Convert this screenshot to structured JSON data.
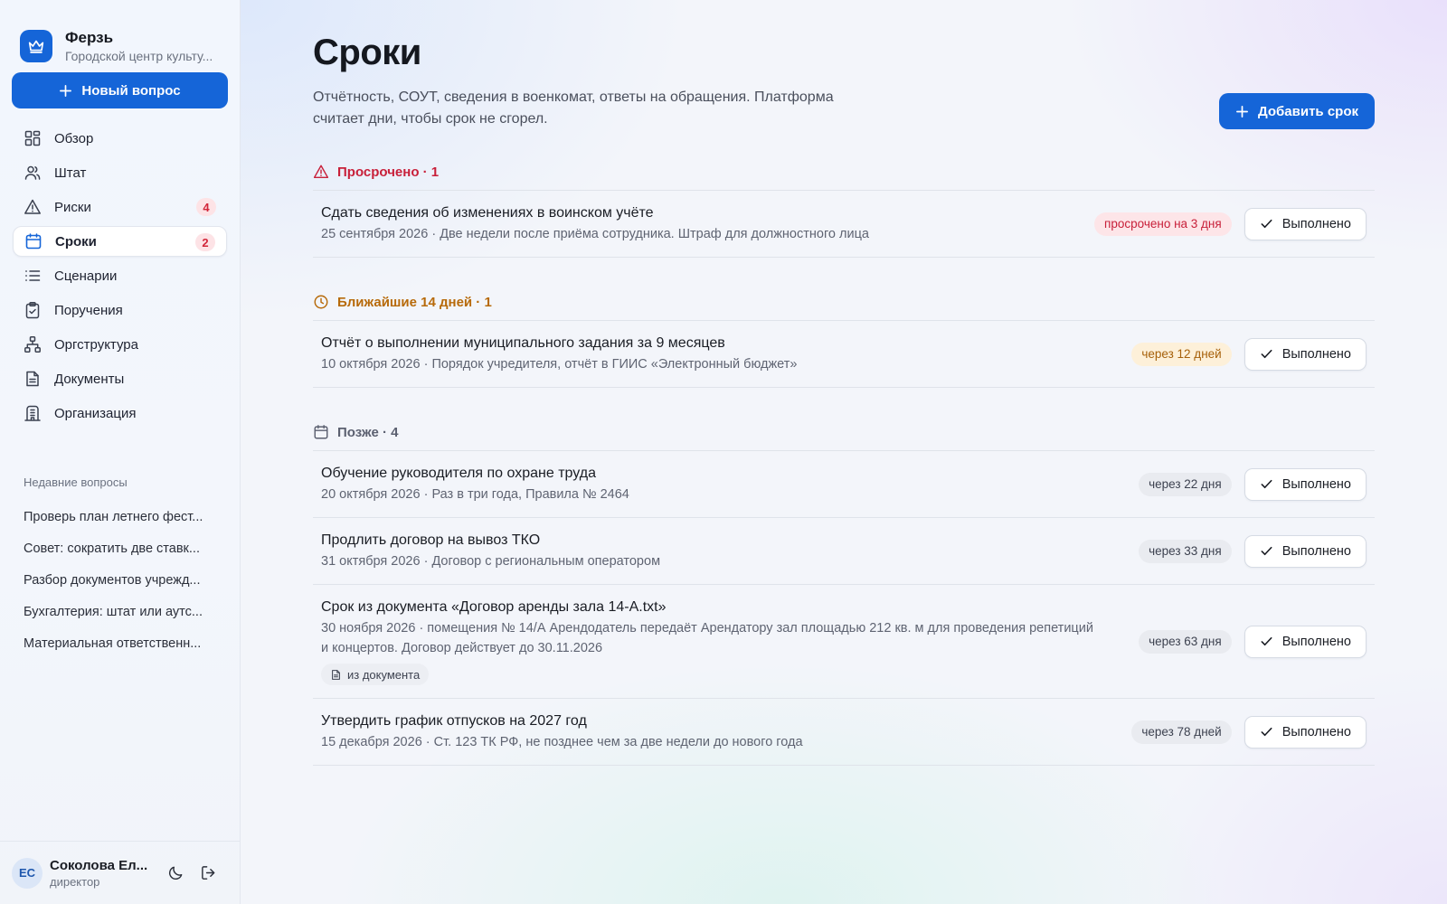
{
  "brand": {
    "name": "Ферзь",
    "subtitle": "Городской центр культу..."
  },
  "sidebar": {
    "new_button": "Новый вопрос",
    "items": [
      {
        "label": "Обзор",
        "icon": "grid-icon"
      },
      {
        "label": "Штат",
        "icon": "users-icon"
      },
      {
        "label": "Риски",
        "icon": "warning-icon",
        "badge": "4"
      },
      {
        "label": "Сроки",
        "icon": "calendar-icon",
        "badge": "2",
        "active": true
      },
      {
        "label": "Сценарии",
        "icon": "list-icon"
      },
      {
        "label": "Поручения",
        "icon": "clipboard-check-icon"
      },
      {
        "label": "Оргструктура",
        "icon": "org-chart-icon"
      },
      {
        "label": "Документы",
        "icon": "document-icon"
      },
      {
        "label": "Организация",
        "icon": "building-icon"
      }
    ],
    "recent_title": "Недавние вопросы",
    "recent": [
      "Проверь план летнего фест...",
      "Совет: сократить две ставк...",
      "Разбор документов учрежд...",
      "Бухгалтерия: штат или аутс...",
      "Материальная ответственн..."
    ]
  },
  "user": {
    "initials": "ЕС",
    "name": "Соколова Ел...",
    "role": "директор"
  },
  "page": {
    "title": "Сроки",
    "description": "Отчётность, СОУТ, сведения в военкомат, ответы на обращения. Платформа считает дни, чтобы срок не сгорел.",
    "add_button": "Добавить срок",
    "done_label": "Выполнено"
  },
  "sections": {
    "overdue": {
      "title": "Просрочено · 1",
      "rows": [
        {
          "title": "Сдать сведения об изменениях в воинском учёте",
          "sub": "25 сентября 2026 · Две недели после приёма сотрудника. Штраф для должностного лица",
          "pill": "просрочено на 3 дня"
        }
      ]
    },
    "soon": {
      "title": "Ближайшие 14 дней · 1",
      "rows": [
        {
          "title": "Отчёт о выполнении муниципального задания за 9 месяцев",
          "sub": "10 октября 2026 · Порядок учредителя, отчёт в ГИИС «Электронный бюджет»",
          "pill": "через 12 дней"
        }
      ]
    },
    "later": {
      "title": "Позже · 4",
      "rows": [
        {
          "title": "Обучение руководителя по охране труда",
          "sub": "20 октября 2026 · Раз в три года, Правила № 2464",
          "pill": "через 22 дня"
        },
        {
          "title": "Продлить договор на вывоз ТКО",
          "sub": "31 октября 2026 · Договор с региональным оператором",
          "pill": "через 33 дня"
        },
        {
          "title": "Срок из документа «Договор аренды зала 14-А.txt»",
          "sub": "30 ноября 2026 · помещения № 14/А Арендодатель передаёт Арендатору зал площадью 212 кв. м для проведения репетиций и концертов. Договор действует до 30.11.2026",
          "tag": "из документа",
          "pill": "через 63 дня"
        },
        {
          "title": "Утвердить график отпусков на 2027 год",
          "sub": "15 декабря 2026 · Ст. 123 ТК РФ, не позднее чем за две недели до нового года",
          "pill": "через 78 дней"
        }
      ]
    }
  },
  "colors": {
    "accent": "#1565d8",
    "danger": "#c8203a",
    "warning": "#b76a0a",
    "muted": "#5b6070"
  }
}
